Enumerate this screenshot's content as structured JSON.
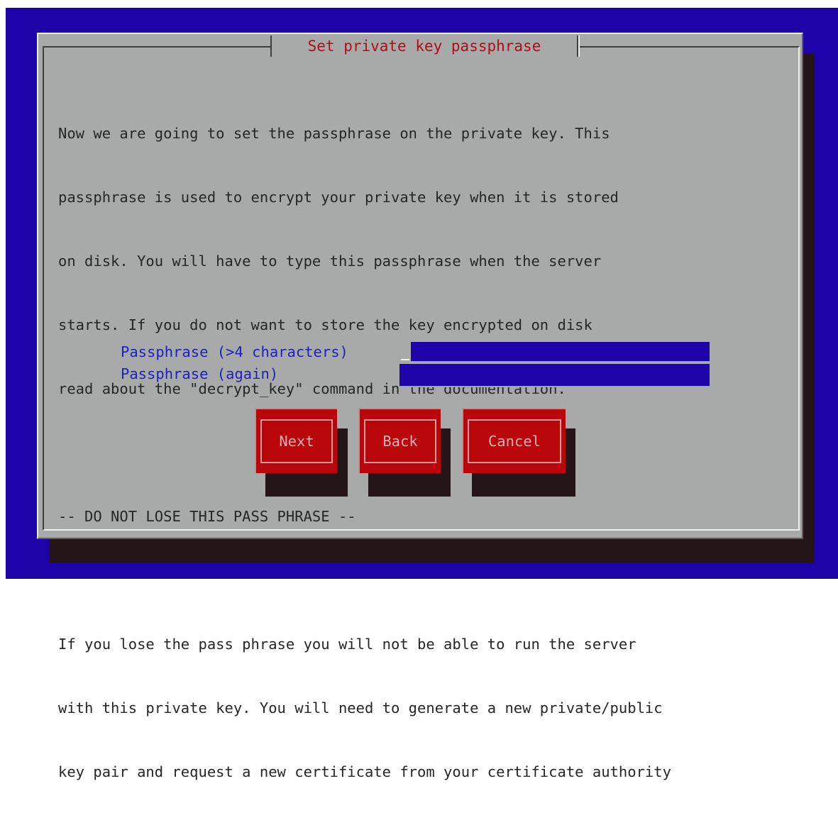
{
  "dialog": {
    "title": "Set private key passphrase",
    "body_lines": [
      "Now we are going to set the passphrase on the private key. This",
      "passphrase is used to encrypt your private key when it is stored",
      "on disk. You will have to type this passphrase when the server",
      "starts. If you do not want to store the key encrypted on disk",
      "read about the \"decrypt_key\" command in the documentation.",
      "",
      "-- DO NOT LOSE THIS PASS PHRASE --",
      "",
      "If you lose the pass phrase you will not be able to run the server",
      "with this private key. You will need to generate a new private/public",
      "key pair and request a new certificate from your certificate authority"
    ]
  },
  "form": {
    "passphrase_label": "Passphrase (>4 characters)",
    "passphrase_value": "",
    "passphrase_again_label": "Passphrase (again)",
    "passphrase_again_value": ""
  },
  "buttons": {
    "next": "Next",
    "back": "Back",
    "cancel": "Cancel"
  },
  "colors": {
    "background": "#1e04a8",
    "dialog": "#a7aaa8",
    "title": "#b20d18",
    "button": "#b8060b",
    "field_label": "#1f1fc0"
  }
}
